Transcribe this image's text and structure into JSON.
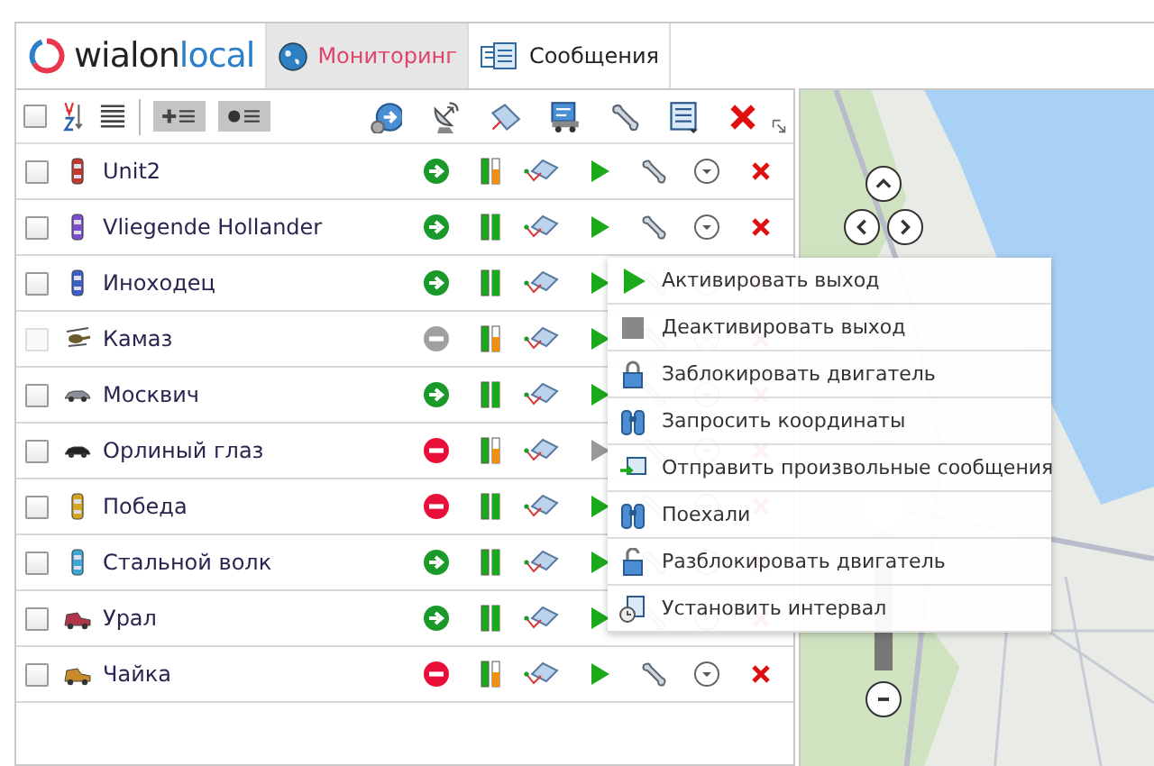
{
  "header": {
    "logo": {
      "first": "wialon",
      "second": "local"
    },
    "tabs": [
      {
        "label": "Мониторинг",
        "selected": true,
        "kind": "globe"
      },
      {
        "label": "Сообщения",
        "selected": false,
        "kind": "messages"
      }
    ]
  },
  "toolbar": {
    "select_all": {
      "checked": false
    }
  },
  "units": [
    {
      "name": "Unit2",
      "checked": false,
      "disabled": false,
      "kind": "car",
      "color": "#c0392b",
      "moving": true,
      "active": true,
      "warning": true,
      "command_available": true
    },
    {
      "name": "Vliegende Hollander",
      "checked": false,
      "disabled": false,
      "kind": "car",
      "color": "#7b4fc9",
      "moving": true,
      "active": true,
      "warning": false,
      "command_available": true
    },
    {
      "name": "Иноходец",
      "checked": false,
      "disabled": false,
      "kind": "car",
      "color": "#3b5fc9",
      "moving": true,
      "active": true,
      "warning": false,
      "command_available": true
    },
    {
      "name": "Камаз",
      "checked": false,
      "disabled": true,
      "kind": "helicopter",
      "color": "#6b5a2a",
      "moving": false,
      "active": false,
      "warning": true,
      "command_available": true
    },
    {
      "name": "Москвич",
      "checked": false,
      "disabled": false,
      "kind": "sedan",
      "color": "#8a8f99",
      "moving": true,
      "active": true,
      "warning": false,
      "command_available": true
    },
    {
      "name": "Орлиный глаз",
      "checked": false,
      "disabled": false,
      "kind": "sedan",
      "color": "#222222",
      "moving": false,
      "active": true,
      "warning": true,
      "command_available": false
    },
    {
      "name": "Победа",
      "checked": false,
      "disabled": false,
      "kind": "car",
      "color": "#d4a520",
      "moving": false,
      "active": true,
      "warning": false,
      "command_available": true
    },
    {
      "name": "Стальной волк",
      "checked": false,
      "disabled": false,
      "kind": "car",
      "color": "#3fa6d8",
      "moving": true,
      "active": true,
      "warning": false,
      "command_available": true
    },
    {
      "name": "Урал",
      "checked": false,
      "disabled": false,
      "kind": "truck",
      "color": "#b0344a",
      "moving": true,
      "active": true,
      "warning": false,
      "command_available": true
    },
    {
      "name": "Чайка",
      "checked": false,
      "disabled": false,
      "kind": "truck",
      "color": "#c98a2a",
      "moving": false,
      "active": true,
      "warning": true,
      "command_available": true
    }
  ],
  "command_menu": [
    {
      "label": "Активировать выход",
      "kind": "play"
    },
    {
      "label": "Деактивировать выход",
      "kind": "stop"
    },
    {
      "label": "Заблокировать двигатель",
      "kind": "lock"
    },
    {
      "label": "Запросить координаты",
      "kind": "binoculars"
    },
    {
      "label": "Отправить произвольные сообщения",
      "kind": "send"
    },
    {
      "label": "Поехали",
      "kind": "binoculars"
    },
    {
      "label": "Разблокировать двигатель",
      "kind": "unlock"
    },
    {
      "label": "Установить интервал",
      "kind": "clock"
    }
  ],
  "map": {
    "zoom": {
      "level": 0.3
    }
  }
}
